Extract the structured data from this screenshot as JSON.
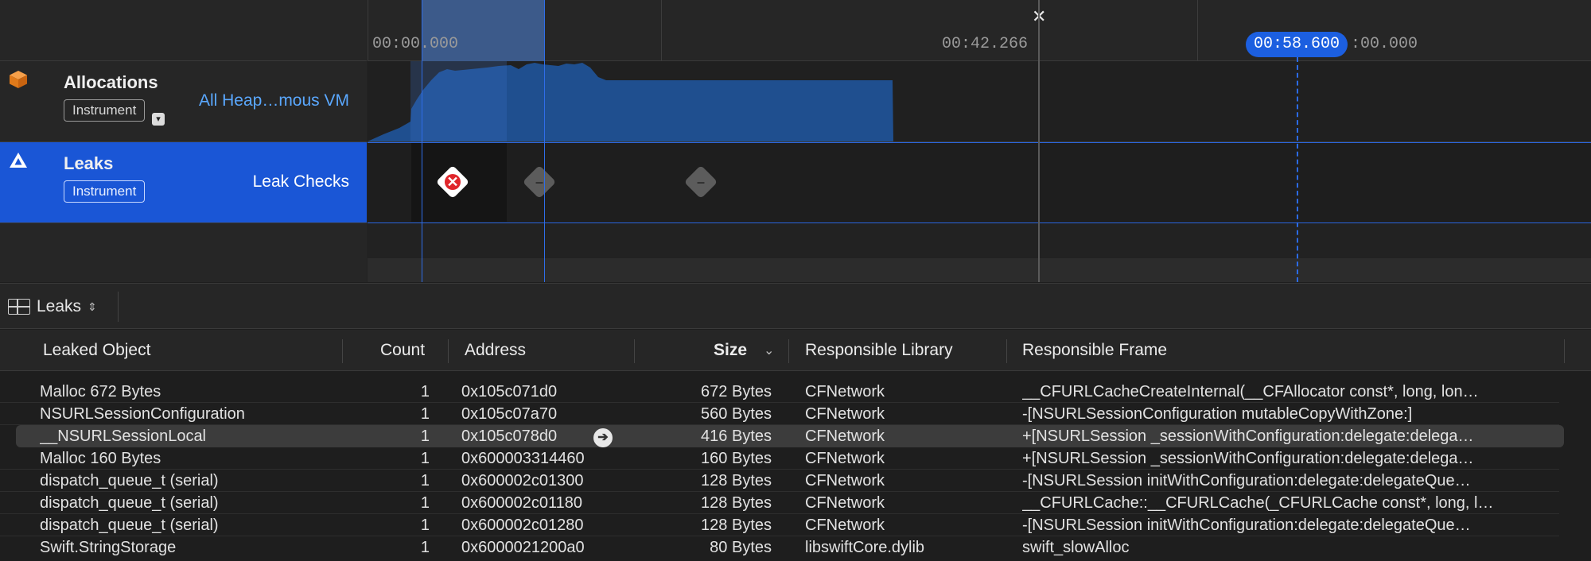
{
  "timeline": {
    "ruler": {
      "ticks": [
        "00:00.000",
        "00:42.266",
        ":00.000"
      ],
      "playhead": "00:58.600",
      "end_marker": "✕"
    },
    "tracks": [
      {
        "title": "Allocations",
        "tag": "Instrument",
        "subtitle": "All Heap…mous VM",
        "icon": "allocations-cube-icon"
      },
      {
        "title": "Leaks",
        "tag": "Instrument",
        "subtitle": "Leak Checks",
        "icon": "leaks-triangle-icon"
      }
    ],
    "leak_checks": [
      {
        "state": "leaks-found",
        "glyph": "✕"
      },
      {
        "state": "no-new-leaks",
        "glyph": "–"
      },
      {
        "state": "no-new-leaks",
        "glyph": "–"
      }
    ]
  },
  "detail": {
    "selector_label": "Leaks",
    "selector_chevron": "⌃⌄"
  },
  "table": {
    "columns": {
      "leaked_object": "Leaked Object",
      "count": "Count",
      "address": "Address",
      "size": "Size",
      "size_sort": "⌄",
      "library": "Responsible Library",
      "frame": "Responsible Frame"
    },
    "rows": [
      {
        "object": "Malloc 672 Bytes",
        "count": "1",
        "address": "0x105c071d0",
        "size": "672 Bytes",
        "library": "CFNetwork",
        "frame": "__CFURLCacheCreateInternal(__CFAllocator const*, long, lon…"
      },
      {
        "object": "NSURLSessionConfiguration",
        "count": "1",
        "address": "0x105c07a70",
        "size": "560 Bytes",
        "library": "CFNetwork",
        "frame": "-[NSURLSessionConfiguration mutableCopyWithZone:]"
      },
      {
        "object": "__NSURLSessionLocal",
        "count": "1",
        "address": "0x105c078d0",
        "size": "416 Bytes",
        "library": "CFNetwork",
        "frame": "+[NSURLSession _sessionWithConfiguration:delegate:delega…"
      },
      {
        "object": "Malloc 160 Bytes",
        "count": "1",
        "address": "0x600003314460",
        "size": "160 Bytes",
        "library": "CFNetwork",
        "frame": "+[NSURLSession _sessionWithConfiguration:delegate:delega…"
      },
      {
        "object": "dispatch_queue_t (serial)",
        "count": "1",
        "address": "0x600002c01300",
        "size": "128 Bytes",
        "library": "CFNetwork",
        "frame": "-[NSURLSession initWithConfiguration:delegate:delegateQue…"
      },
      {
        "object": "dispatch_queue_t (serial)",
        "count": "1",
        "address": "0x600002c01180",
        "size": "128 Bytes",
        "library": "CFNetwork",
        "frame": "__CFURLCache::__CFURLCache(_CFURLCache const*, long, l…"
      },
      {
        "object": "dispatch_queue_t (serial)",
        "count": "1",
        "address": "0x600002c01280",
        "size": "128 Bytes",
        "library": "CFNetwork",
        "frame": "-[NSURLSession initWithConfiguration:delegate:delegateQue…"
      },
      {
        "object": "Swift.StringStorage",
        "count": "1",
        "address": "0x6000021200a0",
        "size": "80 Bytes",
        "library": "libswiftCore.dylib",
        "frame": "swift_slowAlloc"
      }
    ],
    "selected_row": 2,
    "goto_glyph": "➔"
  },
  "colors": {
    "accent": "#1a56d6",
    "alloc_icon": "#f08a24",
    "alloc_graph": "#1f4f8f",
    "leak_found": "#e0262b"
  }
}
